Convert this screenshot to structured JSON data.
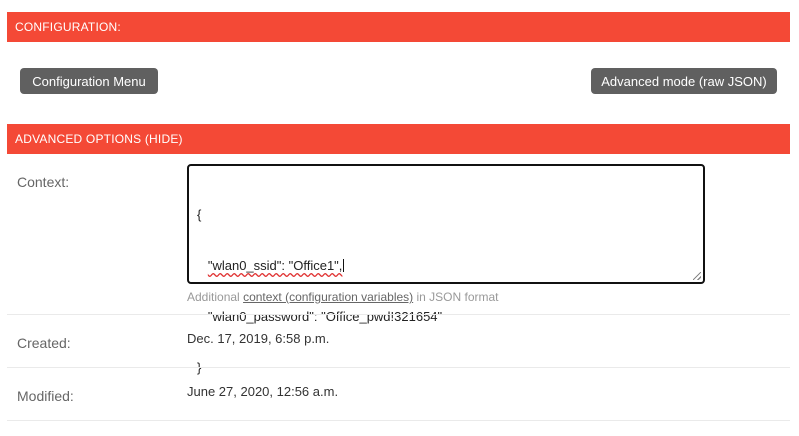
{
  "sections": {
    "configuration_title": "CONFIGURATION:",
    "advanced_title": "ADVANCED OPTIONS (HIDE)"
  },
  "buttons": {
    "configuration_menu": "Configuration Menu",
    "advanced_mode": "Advanced mode (raw JSON)"
  },
  "context": {
    "label": "Context:",
    "lines": [
      "{",
      "\"wlan0_ssid\": \"Office1\",",
      "\"wlan0_password\": \"Office_pwd!321654\"",
      "}"
    ],
    "help_prefix": "Additional",
    "help_link": "context (configuration variables)",
    "help_suffix": "in JSON format"
  },
  "created": {
    "label": "Created:",
    "value": "Dec. 17, 2019, 6:58 p.m."
  },
  "modified": {
    "label": "Modified:",
    "value": "June 27, 2020, 12:56 a.m."
  },
  "colors": {
    "section_bar": "#f44936",
    "button": "#606060"
  }
}
